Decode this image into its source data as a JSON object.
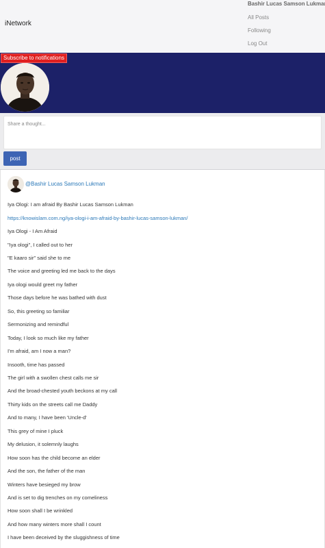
{
  "navbar": {
    "brand": "iNetwork",
    "user_name": "Bashir Lucas Samson Lukman",
    "links": {
      "all_posts": "All Posts",
      "following": "Following",
      "log_out": "Log Out"
    }
  },
  "banner": {
    "subscribe_label": "Subscribe to notifications",
    "background_color": "#1c2168",
    "subscribe_color": "#e01f1f"
  },
  "compose": {
    "placeholder": "Share a thought...",
    "post_label": "post",
    "button_color": "#3d64b4"
  },
  "post": {
    "author": "@Bashir Lucas Samson Lukman",
    "title": "Iya Ologi: I am afraid By Bashir Lucas Samson Lukman",
    "link": "https://knowislam.com.ng/iya-ologi-i-am-afraid-by-bashir-lucas-samson-lukman/",
    "lines": [
      "Iya Ologi - I Am Afraid",
      "\"Iya ologi\", I called out to her",
      "\"E kaaro sir\" said she to me",
      "The voice and greeting led me back to the days",
      "Iya ologi would greet my father",
      "Those days before he was bathed with dust",
      "So, this greeting so familiar",
      "Sermonizing and remindful",
      "Today, I look so much like my father",
      "I'm afraid, am I now a man?",
      "Insooth, time has passed",
      "The girl with a swollen chest calls me sir",
      "And the broad-chested youth beckons at my call",
      "Thirty kids on the streets call me Daddy",
      "And to many, I have been 'Uncle-d'",
      "This grey of mine I pluck",
      "My delusion, it solemnly laughs",
      "How soon has the child become an elder",
      "And the son, the father of the man",
      "Winters have besieged my brow",
      "And is set to dig trenches on my comeliness",
      "How soon shall I be wrinkled",
      "And how many winters more shall I count",
      "I have been deceived by the sluggishness of time"
    ]
  }
}
